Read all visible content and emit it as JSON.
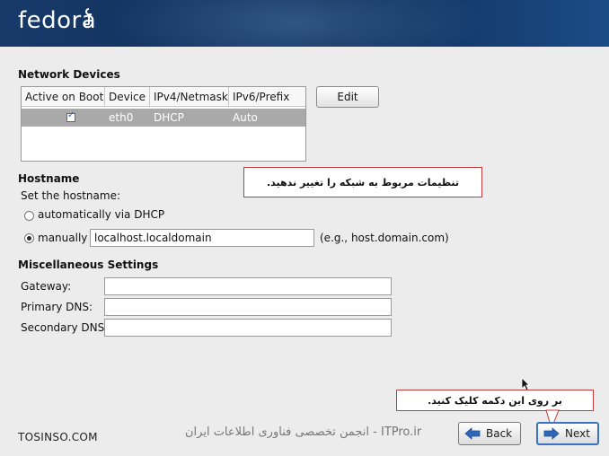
{
  "header": {
    "logo_text": "fedora"
  },
  "network": {
    "title": "Network Devices",
    "columns": [
      "Active on Boot",
      "Device",
      "IPv4/Netmask",
      "IPv6/Prefix"
    ],
    "rows": [
      {
        "device": "eth0",
        "ipv4": "DHCP",
        "ipv6": "Auto"
      }
    ],
    "edit_label": "Edit"
  },
  "hostname": {
    "title": "Hostname",
    "set_label": "Set the hostname:",
    "auto_label": "automatically via DHCP",
    "manual_label": "manually",
    "value": "localhost.localdomain",
    "example": "(e.g., host.domain.com)"
  },
  "misc": {
    "title": "Miscellaneous Settings",
    "gateway_label": "Gateway:",
    "primary_dns_label": "Primary DNS:",
    "secondary_dns_label": "Secondary DNS:"
  },
  "callouts": {
    "network": "تنظیمات مربوط به شبکه را تغییر ندهید.",
    "next": "بر روی این دکمه کلیک کنید."
  },
  "footer": {
    "site": "TOSINSO.COM",
    "watermark": "ITPro.ir - انجمن تخصصی فناوری اطلاعات ایران",
    "back_label": "Back",
    "next_label": "Next"
  },
  "colors": {
    "header_bg": "#173a6a",
    "accent": "#3c72c4",
    "callout_border": "#c23a3a"
  }
}
